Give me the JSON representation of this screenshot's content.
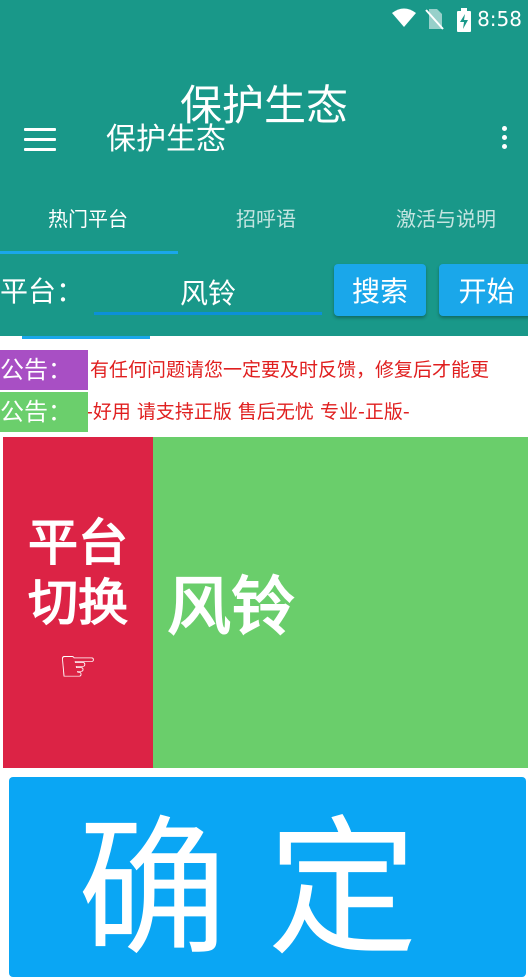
{
  "status_bar": {
    "time": "8:58"
  },
  "header": {
    "title": "保护生态"
  },
  "toolbar": {
    "title": "保护生态"
  },
  "tabs": [
    {
      "label": "热门平台",
      "active": true
    },
    {
      "label": "招呼语",
      "active": false
    },
    {
      "label": "激活与说明",
      "active": false
    }
  ],
  "search": {
    "label": "平台：",
    "value": "风铃",
    "search_button": "搜索",
    "start_button": "开始"
  },
  "notices": [
    {
      "label": "公告：",
      "text": "有任何问题请您一定要及时反馈，修复后才能更"
    },
    {
      "label": "公告：",
      "text": "-好用        请支持正版 售后无忧 专业-正版-"
    }
  ],
  "switch_panel": {
    "line1": "平台",
    "line2": "切换",
    "icon": "☞"
  },
  "current_platform": "风铃",
  "confirm_button": "确定",
  "colors": {
    "primary": "#199889",
    "accent": "#1aa7ea",
    "switch_panel": "#dc2345",
    "current_panel": "#6ace6b",
    "confirm": "#0aa6f4",
    "notice_text": "#e01f1f",
    "notice_label_1": "#a84fc4",
    "notice_label_2": "#6bcf6c"
  }
}
